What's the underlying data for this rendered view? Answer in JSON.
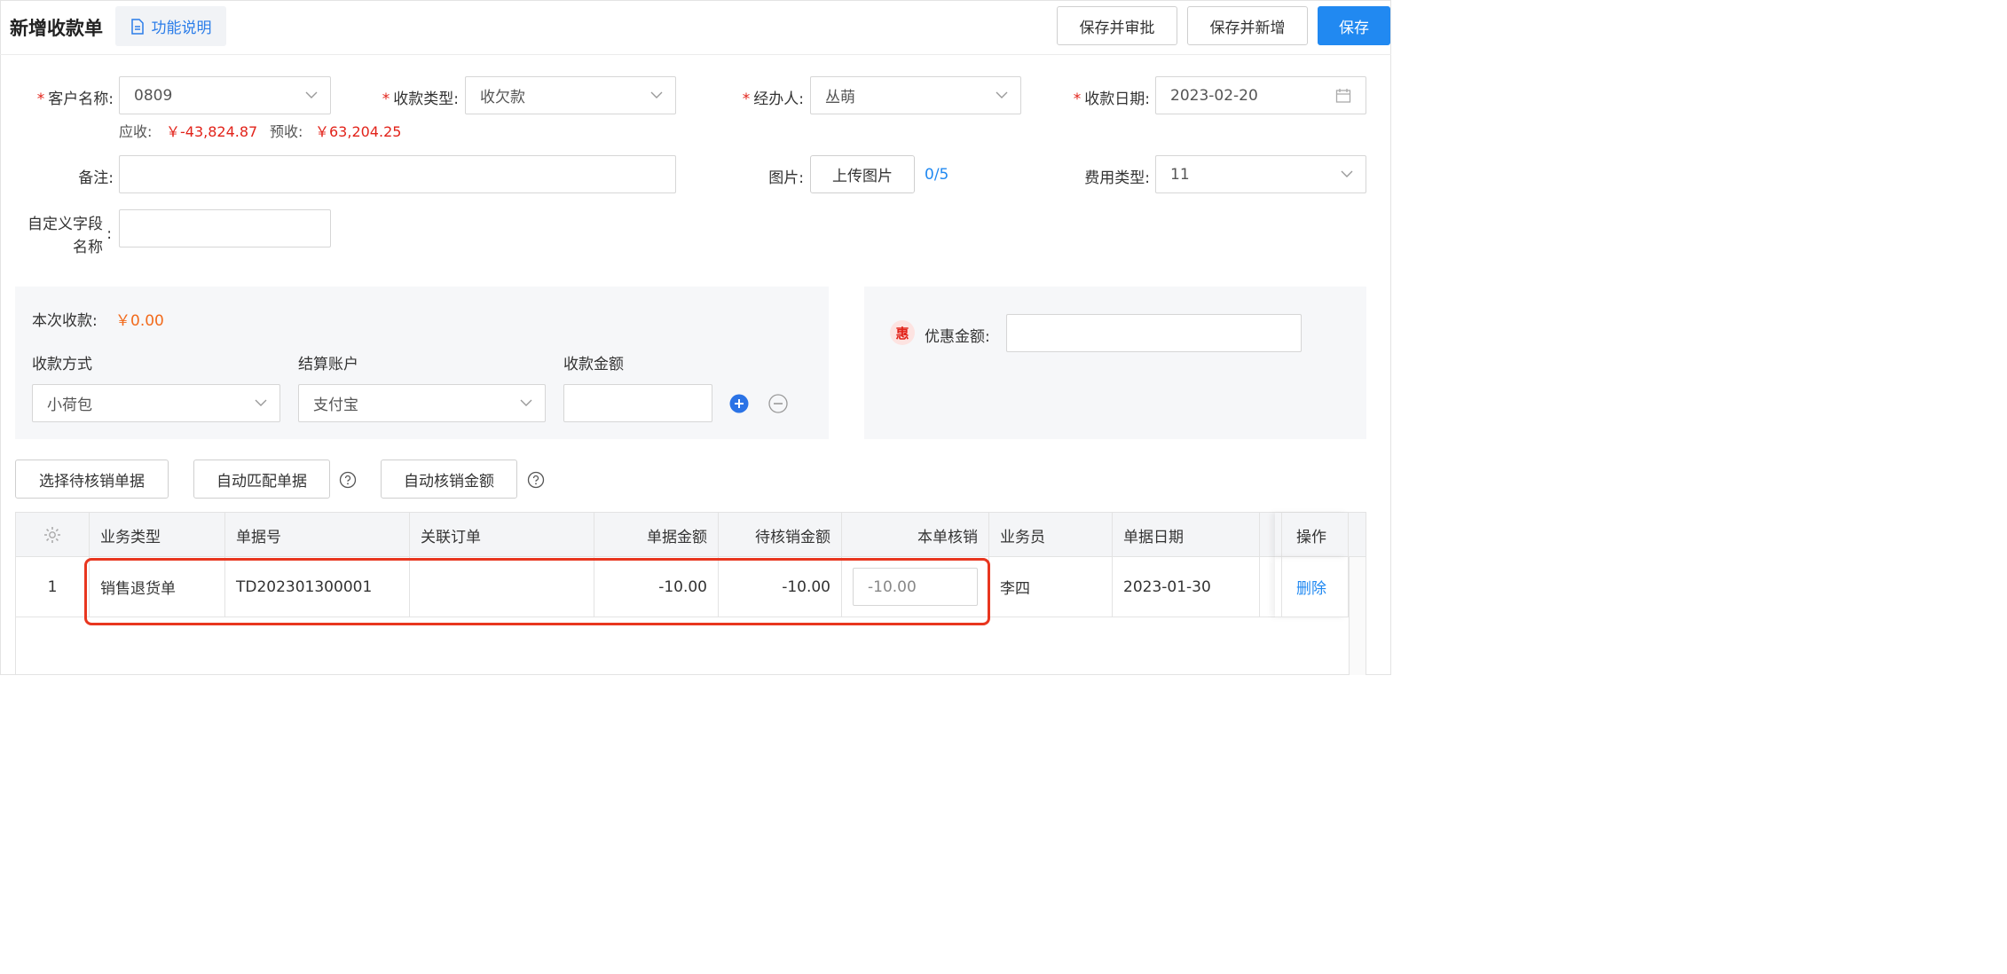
{
  "header": {
    "title": "新增收款单",
    "help_label": "功能说明",
    "buttons": {
      "save_approve": "保存并审批",
      "save_new": "保存并新增",
      "save": "保存"
    }
  },
  "form": {
    "customer": {
      "label": "客户名称",
      "value": "0809"
    },
    "receipt_type": {
      "label": "收款类型",
      "value": "收欠款"
    },
    "handler": {
      "label": "经办人",
      "value": "丛萌"
    },
    "receipt_date": {
      "label": "收款日期",
      "value": "2023-02-20"
    },
    "receivable_label": "应收:",
    "receivable_value": "￥-43,824.87",
    "prepaid_label": "预收:",
    "prepaid_value": "￥63,204.25",
    "remark": {
      "label": "备注",
      "value": ""
    },
    "picture": {
      "label": "图片",
      "upload_label": "上传图片",
      "count": "0/5"
    },
    "expense_type": {
      "label": "费用类型",
      "value": "11"
    },
    "custom_field": {
      "label_line1": "自定义字段",
      "label_line2": "名称",
      "value": ""
    }
  },
  "payment": {
    "this_receipt_label": "本次收款:",
    "this_receipt_value": "￥0.00",
    "method_label": "收款方式",
    "account_label": "结算账户",
    "amount_label": "收款金额",
    "method_value": "小荷包",
    "account_value": "支付宝",
    "amount_value": ""
  },
  "discount": {
    "badge": "惠",
    "label": "优惠金额:",
    "value": ""
  },
  "actions": {
    "select_docs": "选择待核销单据",
    "auto_match": "自动匹配单据",
    "auto_writeoff": "自动核销金额"
  },
  "table": {
    "headers": [
      "业务类型",
      "单据号",
      "关联订单",
      "单据金额",
      "待核销金额",
      "本单核销",
      "业务员",
      "单据日期",
      "",
      "操作"
    ],
    "rows": [
      {
        "index": "1",
        "biz_type": "销售退货单",
        "doc_no": "TD202301300001",
        "related_order": "",
        "doc_amount": "-10.00",
        "pending_amount": "-10.00",
        "writeoff_amount": "-10.00",
        "salesman": "李四",
        "doc_date": "2023-01-30",
        "action": "删除"
      }
    ]
  },
  "colors": {
    "primary": "#2189f1",
    "danger": "#e2231a",
    "orange": "#f26b1d",
    "highlight": "#e8361f"
  }
}
